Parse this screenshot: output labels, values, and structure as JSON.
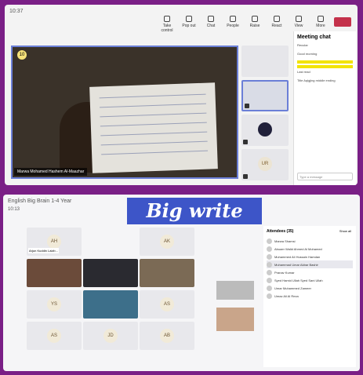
{
  "top_window": {
    "title": "10:37",
    "toolbar": [
      {
        "label": "Take control",
        "icon": "control-icon"
      },
      {
        "label": "Pop out",
        "icon": "popout-icon"
      },
      {
        "label": "Chat",
        "icon": "chat-icon"
      },
      {
        "label": "People",
        "icon": "people-icon"
      },
      {
        "label": "Raise",
        "icon": "raise-hand-icon"
      },
      {
        "label": "React",
        "icon": "react-icon"
      },
      {
        "label": "View",
        "icon": "view-icon"
      },
      {
        "label": "More",
        "icon": "more-icon"
      }
    ],
    "stage": {
      "participant_count": "10",
      "name": "Marwa Mohamed Hashem Al-Maazhar"
    },
    "rail_avatars": [
      "UR"
    ],
    "chat": {
      "title": "Meeting chat",
      "placeholder": "Type a message",
      "messages": [
        "Recular",
        "Good morning",
        "Title Aqlgjing middle ending"
      ],
      "read_label": "Last read"
    }
  },
  "banner": "Big write",
  "bottom_window": {
    "title": "English Big Brain 1-4 Year",
    "time": "10:13",
    "tiles": [
      "AH",
      "AK",
      "YS",
      "AS",
      "AS",
      "JD",
      "AB"
    ],
    "tile_label": "Arjun Kuddin Laizb...",
    "attendees_header": "Attendees (35)",
    "show_all": "Show all",
    "attendees": [
      "Marwa Shamsi",
      "Abuaer Walid Ahmed Al Mohamed",
      "Muhammed Ali Hussain Hamdan",
      "Muhammad Umar Akbar Bashir",
      "Pranav Kumar",
      "Syed Hamid Ullah Syed Sani Ullah",
      "Umar Muhammed Zameer",
      "Umaz Ali Al Reza"
    ]
  }
}
